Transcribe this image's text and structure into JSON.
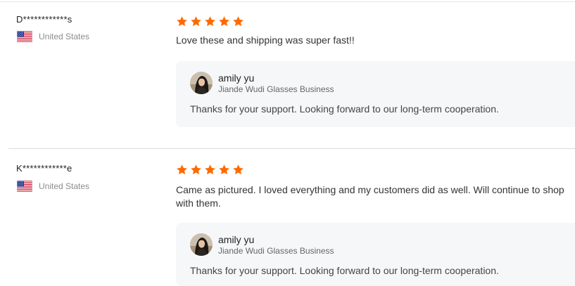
{
  "reviews": [
    {
      "reviewer": "D************s",
      "country": "United States",
      "flag_icon": "us-flag-icon",
      "rating": 5,
      "text": "Love these and shipping was super fast!!",
      "reply": {
        "seller_name": "amily yu",
        "company": "Jiande Wudi Glasses Business",
        "text": "Thanks for your support. Looking forward to our long-term cooperation."
      }
    },
    {
      "reviewer": "K************e",
      "country": "United States",
      "flag_icon": "us-flag-icon",
      "rating": 5,
      "text": "Came as pictured.  I loved everything and my customers did as well. Will continue to shop with them.",
      "reply": {
        "seller_name": "amily yu",
        "company": "Jiande Wudi Glasses Business",
        "text": "Thanks for your support. Looking forward to our long-term cooperation."
      }
    }
  ],
  "colors": {
    "star": "#ff6a00",
    "reply_bg": "#f6f7f9",
    "muted_text": "#8c8c8c"
  }
}
